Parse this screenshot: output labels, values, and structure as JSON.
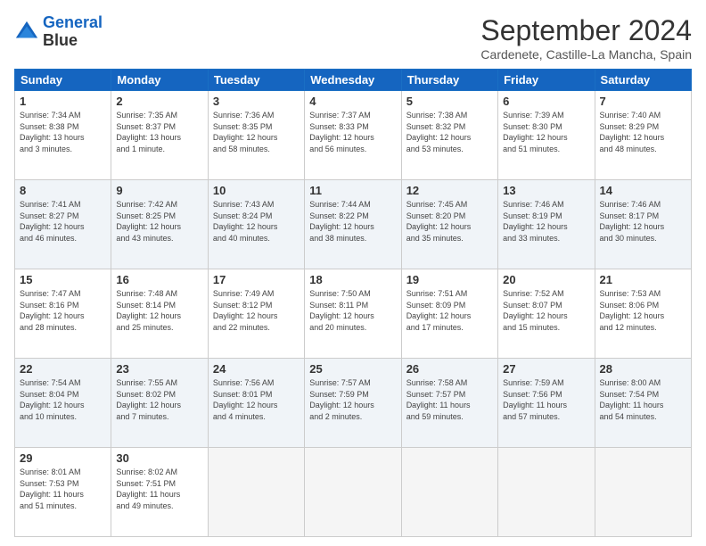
{
  "logo": {
    "line1": "General",
    "line2": "Blue"
  },
  "title": "September 2024",
  "subtitle": "Cardenete, Castille-La Mancha, Spain",
  "headers": [
    "Sunday",
    "Monday",
    "Tuesday",
    "Wednesday",
    "Thursday",
    "Friday",
    "Saturday"
  ],
  "weeks": [
    [
      {
        "day": "1",
        "info": "Sunrise: 7:34 AM\nSunset: 8:38 PM\nDaylight: 13 hours\nand 3 minutes."
      },
      {
        "day": "2",
        "info": "Sunrise: 7:35 AM\nSunset: 8:37 PM\nDaylight: 13 hours\nand 1 minute."
      },
      {
        "day": "3",
        "info": "Sunrise: 7:36 AM\nSunset: 8:35 PM\nDaylight: 12 hours\nand 58 minutes."
      },
      {
        "day": "4",
        "info": "Sunrise: 7:37 AM\nSunset: 8:33 PM\nDaylight: 12 hours\nand 56 minutes."
      },
      {
        "day": "5",
        "info": "Sunrise: 7:38 AM\nSunset: 8:32 PM\nDaylight: 12 hours\nand 53 minutes."
      },
      {
        "day": "6",
        "info": "Sunrise: 7:39 AM\nSunset: 8:30 PM\nDaylight: 12 hours\nand 51 minutes."
      },
      {
        "day": "7",
        "info": "Sunrise: 7:40 AM\nSunset: 8:29 PM\nDaylight: 12 hours\nand 48 minutes."
      }
    ],
    [
      {
        "day": "8",
        "info": "Sunrise: 7:41 AM\nSunset: 8:27 PM\nDaylight: 12 hours\nand 46 minutes."
      },
      {
        "day": "9",
        "info": "Sunrise: 7:42 AM\nSunset: 8:25 PM\nDaylight: 12 hours\nand 43 minutes."
      },
      {
        "day": "10",
        "info": "Sunrise: 7:43 AM\nSunset: 8:24 PM\nDaylight: 12 hours\nand 40 minutes."
      },
      {
        "day": "11",
        "info": "Sunrise: 7:44 AM\nSunset: 8:22 PM\nDaylight: 12 hours\nand 38 minutes."
      },
      {
        "day": "12",
        "info": "Sunrise: 7:45 AM\nSunset: 8:20 PM\nDaylight: 12 hours\nand 35 minutes."
      },
      {
        "day": "13",
        "info": "Sunrise: 7:46 AM\nSunset: 8:19 PM\nDaylight: 12 hours\nand 33 minutes."
      },
      {
        "day": "14",
        "info": "Sunrise: 7:46 AM\nSunset: 8:17 PM\nDaylight: 12 hours\nand 30 minutes."
      }
    ],
    [
      {
        "day": "15",
        "info": "Sunrise: 7:47 AM\nSunset: 8:16 PM\nDaylight: 12 hours\nand 28 minutes."
      },
      {
        "day": "16",
        "info": "Sunrise: 7:48 AM\nSunset: 8:14 PM\nDaylight: 12 hours\nand 25 minutes."
      },
      {
        "day": "17",
        "info": "Sunrise: 7:49 AM\nSunset: 8:12 PM\nDaylight: 12 hours\nand 22 minutes."
      },
      {
        "day": "18",
        "info": "Sunrise: 7:50 AM\nSunset: 8:11 PM\nDaylight: 12 hours\nand 20 minutes."
      },
      {
        "day": "19",
        "info": "Sunrise: 7:51 AM\nSunset: 8:09 PM\nDaylight: 12 hours\nand 17 minutes."
      },
      {
        "day": "20",
        "info": "Sunrise: 7:52 AM\nSunset: 8:07 PM\nDaylight: 12 hours\nand 15 minutes."
      },
      {
        "day": "21",
        "info": "Sunrise: 7:53 AM\nSunset: 8:06 PM\nDaylight: 12 hours\nand 12 minutes."
      }
    ],
    [
      {
        "day": "22",
        "info": "Sunrise: 7:54 AM\nSunset: 8:04 PM\nDaylight: 12 hours\nand 10 minutes."
      },
      {
        "day": "23",
        "info": "Sunrise: 7:55 AM\nSunset: 8:02 PM\nDaylight: 12 hours\nand 7 minutes."
      },
      {
        "day": "24",
        "info": "Sunrise: 7:56 AM\nSunset: 8:01 PM\nDaylight: 12 hours\nand 4 minutes."
      },
      {
        "day": "25",
        "info": "Sunrise: 7:57 AM\nSunset: 7:59 PM\nDaylight: 12 hours\nand 2 minutes."
      },
      {
        "day": "26",
        "info": "Sunrise: 7:58 AM\nSunset: 7:57 PM\nDaylight: 11 hours\nand 59 minutes."
      },
      {
        "day": "27",
        "info": "Sunrise: 7:59 AM\nSunset: 7:56 PM\nDaylight: 11 hours\nand 57 minutes."
      },
      {
        "day": "28",
        "info": "Sunrise: 8:00 AM\nSunset: 7:54 PM\nDaylight: 11 hours\nand 54 minutes."
      }
    ],
    [
      {
        "day": "29",
        "info": "Sunrise: 8:01 AM\nSunset: 7:53 PM\nDaylight: 11 hours\nand 51 minutes."
      },
      {
        "day": "30",
        "info": "Sunrise: 8:02 AM\nSunset: 7:51 PM\nDaylight: 11 hours\nand 49 minutes."
      },
      {
        "day": "",
        "info": ""
      },
      {
        "day": "",
        "info": ""
      },
      {
        "day": "",
        "info": ""
      },
      {
        "day": "",
        "info": ""
      },
      {
        "day": "",
        "info": ""
      }
    ]
  ]
}
